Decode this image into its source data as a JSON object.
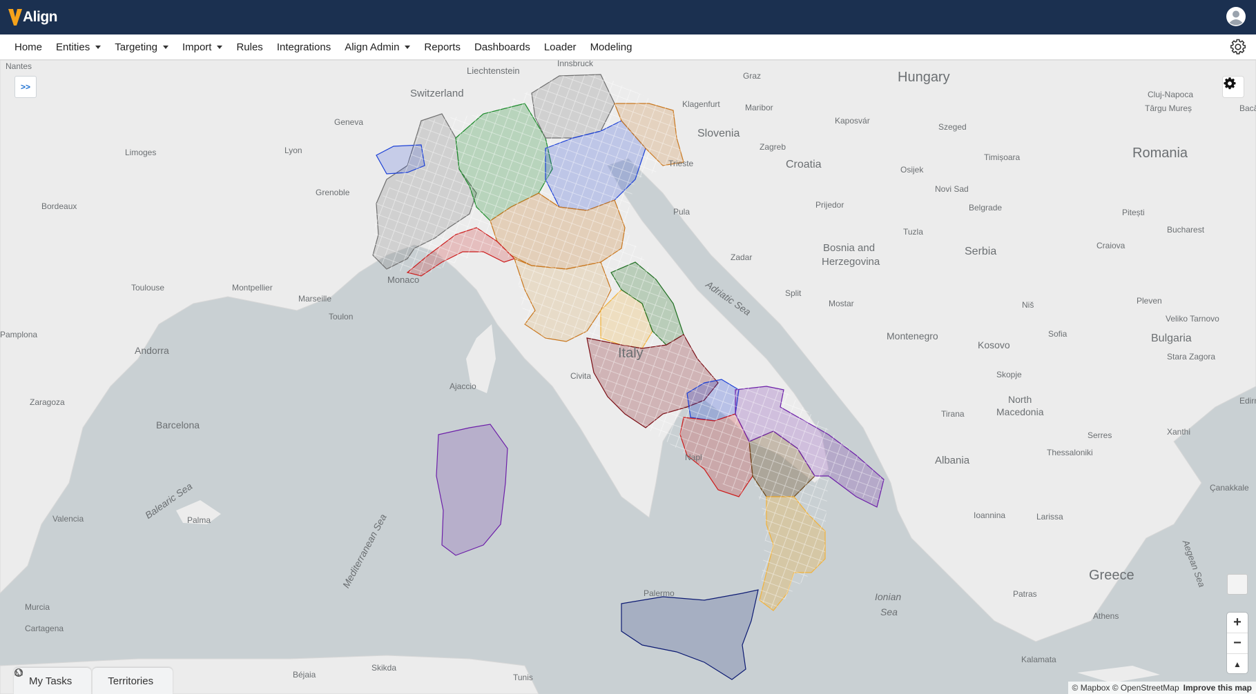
{
  "app": {
    "brand": "Align"
  },
  "nav": {
    "items": [
      {
        "label": "Home",
        "dropdown": false
      },
      {
        "label": "Entities",
        "dropdown": true
      },
      {
        "label": "Targeting",
        "dropdown": true
      },
      {
        "label": "Import",
        "dropdown": true
      },
      {
        "label": "Rules",
        "dropdown": false
      },
      {
        "label": "Integrations",
        "dropdown": false
      },
      {
        "label": "Align Admin",
        "dropdown": true
      },
      {
        "label": "Reports",
        "dropdown": false
      },
      {
        "label": "Dashboards",
        "dropdown": false
      },
      {
        "label": "Loader",
        "dropdown": false
      },
      {
        "label": "Modeling",
        "dropdown": false
      }
    ],
    "settings_icon": "gear-icon",
    "user_icon": "user-avatar-icon"
  },
  "map": {
    "expand_label": ">>",
    "labels": {
      "countries": [
        "Hungary",
        "Romania",
        "Slovenia",
        "Croatia",
        "Bosnia and",
        "Herzegovina",
        "Serbia",
        "Montenegro",
        "Kosovo",
        "Bulgaria",
        "North",
        "Macedonia",
        "Albania",
        "Greece",
        "Italy",
        "Switzerland",
        "Liechtenstein",
        "Monaco",
        "Andorra"
      ],
      "seas": [
        "Adriatic Sea",
        "Ionian",
        "Sea",
        "Mediterranean Sea",
        "Balearic Sea",
        "Aegean Sea"
      ],
      "cities": [
        "Nantes",
        "Lyon",
        "Geneva",
        "Limoges",
        "Grenoble",
        "Bordeaux",
        "Toulouse",
        "Montpellier",
        "Marseille",
        "Toulon",
        "Pamplona",
        "Zaragoza",
        "Barcelona",
        "Valencia",
        "Palma",
        "Murcia",
        "Cartagena",
        "Ajaccio",
        "Civita",
        "Napl",
        "Palermo",
        "Skikda",
        "Béjaia",
        "Tunis",
        "Innsbruck",
        "Graz",
        "Klagenfurt",
        "Maribor",
        "Kaposvár",
        "Szeged",
        "Cluj-Napoca",
        "Târgu Mureș",
        "Zagreb",
        "Osijek",
        "Timișoara",
        "Novi Sad",
        "Belgrade",
        "Pula",
        "Prijedor",
        "Tuzla",
        "Zadar",
        "Split",
        "Mostar",
        "Niš",
        "Pitești",
        "Craiova",
        "Bucharest",
        "Pleven",
        "Veliko Tarnovo",
        "Sofia",
        "Stara Zagora",
        "Skopje",
        "Tirana",
        "Edirne",
        "Xanthi",
        "Serres",
        "Thessaloniki",
        "Ioannina",
        "Larissa",
        "Patras",
        "Athens",
        "Kalamata",
        "Çanakkale",
        "Bacău",
        "Trieste"
      ]
    },
    "attribution": "© Mapbox © OpenStreetMap",
    "improve_link": "Improve this map",
    "zoom_in": "+",
    "zoom_out": "−",
    "compass": "▲"
  },
  "bottom_tabs": [
    {
      "label": "My Tasks",
      "icon": "bell-icon"
    },
    {
      "label": "Territories",
      "icon": "globe-icon"
    }
  ],
  "colors": {
    "header_bg": "#1b3050",
    "brand_accent": "#f5a21b",
    "territory_gray": "#6e6e6e",
    "territory_green": "#1c8a2a",
    "territory_blue": "#1a3fd6",
    "territory_orange": "#c9771e",
    "territory_tan": "#d9a85b",
    "territory_red": "#cc1b1b",
    "territory_darkred": "#7a0d14",
    "territory_purple": "#6c1ea8",
    "territory_brown": "#6a4518",
    "territory_yellow": "#f2b23a",
    "territory_navy": "#0c1a72",
    "territory_darkgreen": "#1e6e20"
  }
}
